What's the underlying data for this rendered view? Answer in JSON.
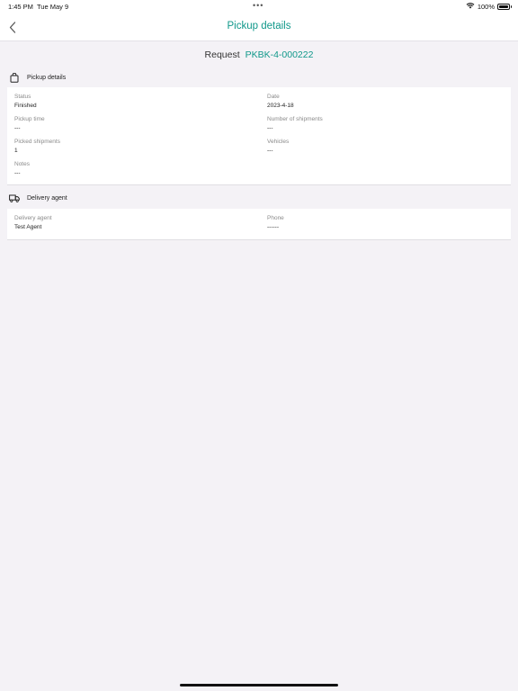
{
  "status_bar": {
    "time": "1:45 PM",
    "date": "Tue May 9",
    "dots": "•••",
    "battery": "100%"
  },
  "nav": {
    "title": "Pickup details"
  },
  "request": {
    "label": "Request",
    "id": "PKBK-4-000222"
  },
  "pickup_section": {
    "title": "Pickup details",
    "fields": {
      "status": {
        "label": "Status",
        "value": "Finished"
      },
      "date": {
        "label": "Date",
        "value": "2023-4-18"
      },
      "pickup_time": {
        "label": "Pickup time",
        "value": "---"
      },
      "number_of_shipments": {
        "label": "Number of shipments",
        "value": "---"
      },
      "picked_shipments": {
        "label": "Picked shipments",
        "value": "1"
      },
      "vehicles": {
        "label": "Vehicles",
        "value": "---"
      },
      "notes": {
        "label": "Notes",
        "value": "---"
      }
    }
  },
  "agent_section": {
    "title": "Delivery agent",
    "fields": {
      "delivery_agent": {
        "label": "Delivery agent",
        "value": "Test Agent"
      },
      "phone": {
        "label": "Phone",
        "value": "------"
      }
    }
  },
  "colors": {
    "accent": "#10988a",
    "background": "#f4f2f6",
    "card": "#ffffff"
  }
}
